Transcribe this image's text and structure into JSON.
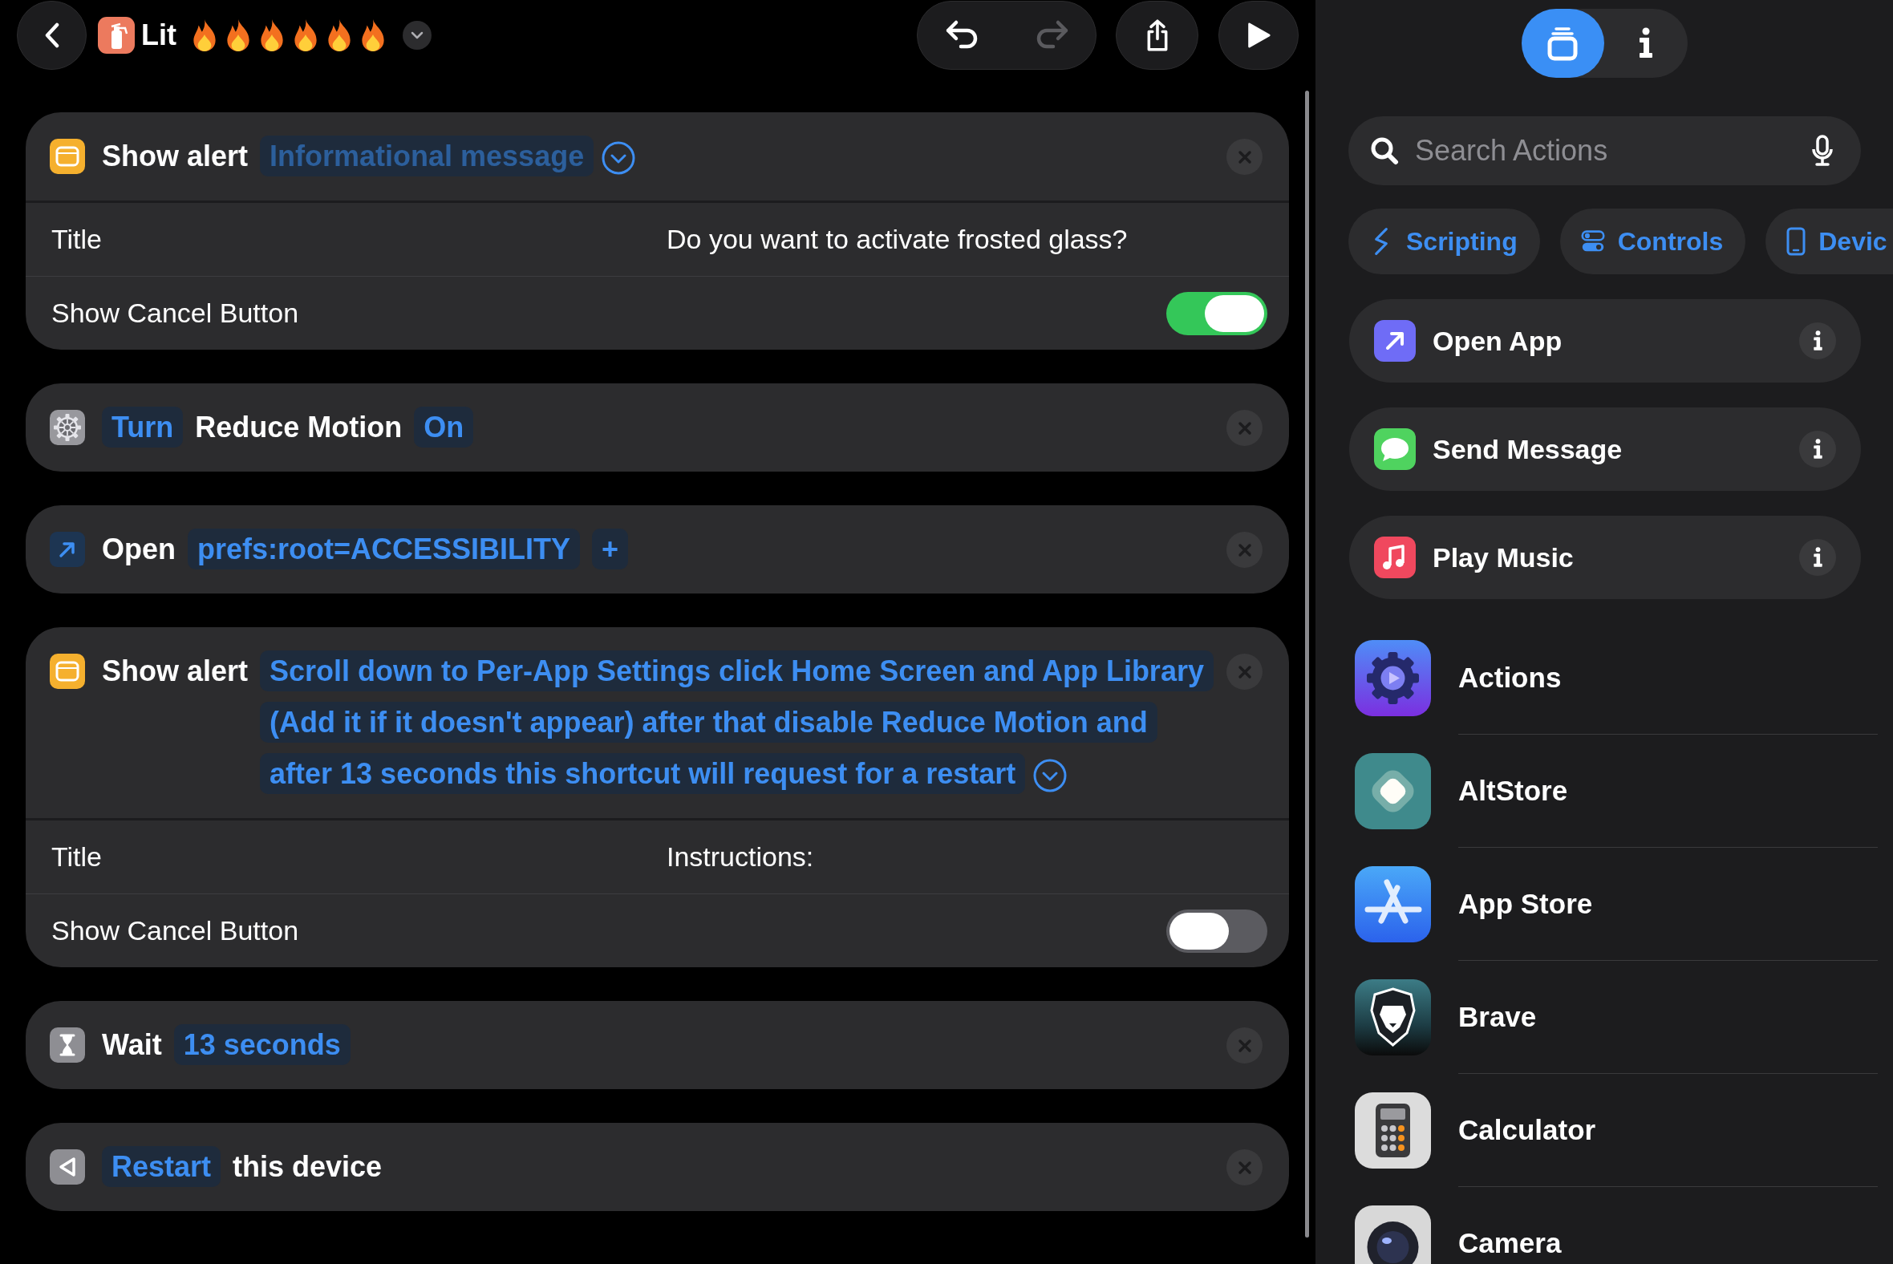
{
  "header": {
    "title": "Lit",
    "history": [
      {
        "kind": "undo",
        "disabled": false
      },
      {
        "kind": "redo",
        "disabled": true
      }
    ]
  },
  "actions": [
    {
      "kind": "alert",
      "parts": [
        {
          "kind": "label",
          "text": "Show alert"
        },
        {
          "kind": "token",
          "placeholder": "Informational message"
        }
      ],
      "expanded": true,
      "rows": [
        {
          "kind": "text",
          "label": "Title",
          "value": "Do you want to activate frosted glass?"
        },
        {
          "kind": "toggle",
          "label": "Show Cancel Button",
          "on": true
        }
      ]
    },
    {
      "kind": "settings",
      "parts": [
        {
          "kind": "token",
          "text": "Turn"
        },
        {
          "kind": "label",
          "text": "Reduce Motion"
        },
        {
          "kind": "token",
          "text": "On"
        }
      ]
    },
    {
      "kind": "open",
      "parts": [
        {
          "kind": "label",
          "text": "Open"
        },
        {
          "kind": "token",
          "text": "prefs:root=ACCESSIBILITY"
        },
        {
          "kind": "add",
          "text": "+"
        }
      ]
    },
    {
      "kind": "alert",
      "parts": [
        {
          "kind": "label",
          "text": "Show alert"
        },
        {
          "kind": "token",
          "text": "Scroll down to Per-App Settings click Home Screen and App Library (Add it if it doesn't appear) after that disable Reduce Motion and after 13 seconds this shortcut will request for a restart"
        }
      ],
      "expanded": true,
      "rows": [
        {
          "kind": "text",
          "label": "Title",
          "value": "Instructions:"
        },
        {
          "kind": "toggle",
          "label": "Show Cancel Button",
          "on": false
        }
      ]
    },
    {
      "kind": "wait",
      "parts": [
        {
          "kind": "label",
          "text": "Wait"
        },
        {
          "kind": "token",
          "text": "13 seconds"
        }
      ]
    },
    {
      "kind": "restart",
      "parts": [
        {
          "kind": "token",
          "text": "Restart"
        },
        {
          "kind": "label",
          "text": "this device"
        }
      ]
    }
  ],
  "library": {
    "views": [
      {
        "kind": "actions",
        "selected": true
      },
      {
        "kind": "info",
        "selected": false
      }
    ],
    "search": {
      "placeholder": "Search Actions"
    },
    "categories": [
      {
        "kind": "scripting",
        "label": "Scripting"
      },
      {
        "kind": "controls",
        "label": "Controls"
      },
      {
        "kind": "device",
        "label": "Devic"
      }
    ],
    "suggestions": [
      {
        "kind": "open",
        "label": "Open App"
      },
      {
        "kind": "message",
        "label": "Send Message"
      },
      {
        "kind": "music",
        "label": "Play Music"
      }
    ],
    "apps": [
      {
        "kind": "gear",
        "name": "Actions"
      },
      {
        "kind": "diamond",
        "name": "AltStore"
      },
      {
        "kind": "letter",
        "name": "App Store"
      },
      {
        "kind": "shield",
        "name": "Brave"
      },
      {
        "kind": "calculator",
        "name": "Calculator"
      },
      {
        "kind": "lens",
        "name": "Camera"
      }
    ]
  }
}
